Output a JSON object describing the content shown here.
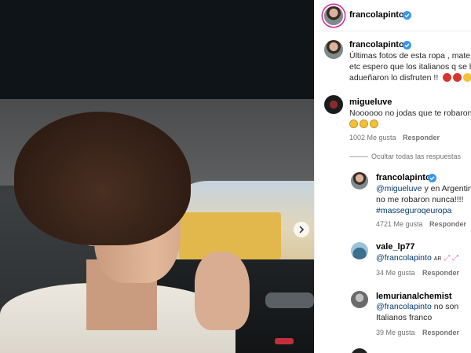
{
  "post": {
    "author": "francolapinto",
    "caption_lines": [
      "Últimas fotos de esta ropa , mate e",
      "etc espero que los italianos q se lo",
      "adueñaron lo disfruten !!"
    ]
  },
  "comments": [
    {
      "username": "migueluve",
      "text": "Noooooo no jodas que te robaron",
      "likes": "1002 Me gusta",
      "reply": "Responder"
    }
  ],
  "hide_replies": "Ocultar todas las respuestas",
  "replies": [
    {
      "username": "francolapinto",
      "mention": "@migueluve",
      "text_after_mention": " y en Argentin",
      "line2": "no me robaron nunca!!!!",
      "hashtag": "#masseguroqeuropa",
      "likes": "4721 Me gusta",
      "reply": "Responder"
    },
    {
      "username": "vale_lp77",
      "mention": "@francolapinto",
      "suffix": "AR",
      "likes": "34 Me gusta",
      "reply": "Responder"
    },
    {
      "username": "lemurianalchemist",
      "mention": "@francolapinto",
      "text_after_mention": " no son",
      "line2": "Italianos franco",
      "likes": "39 Me gusta",
      "reply": "Responder"
    }
  ],
  "colors": {
    "verified": "#3897f0",
    "mention": "#00376b",
    "meta": "#737373"
  },
  "icons": [
    "verified-badge-icon",
    "chevron-right-icon",
    "emoji-icon"
  ]
}
